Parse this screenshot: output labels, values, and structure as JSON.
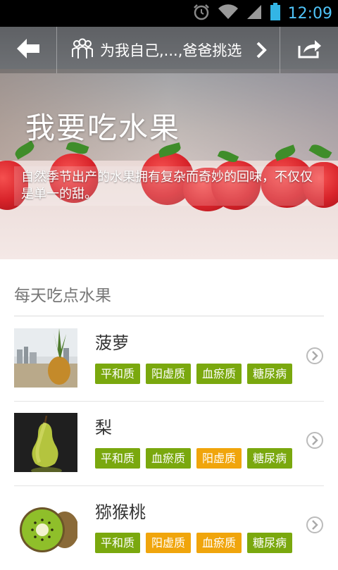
{
  "status_bar": {
    "time": "12:09"
  },
  "header": {
    "selector_label": "为我自己,...,爸爸挑选"
  },
  "hero": {
    "title": "我要吃水果",
    "description": "自然季节出产的水果拥有复杂而奇妙的回味，不仅仅是单一的甜。"
  },
  "section": {
    "title": "每天吃点水果"
  },
  "colors": {
    "tag_green": "#7aa80e",
    "tag_orange": "#f0a50c"
  },
  "fruits": [
    {
      "name": "菠萝",
      "tags": [
        {
          "label": "平和质",
          "color": "green"
        },
        {
          "label": "阳虚质",
          "color": "green"
        },
        {
          "label": "血瘀质",
          "color": "green"
        },
        {
          "label": "糖尿病",
          "color": "green"
        }
      ]
    },
    {
      "name": "梨",
      "tags": [
        {
          "label": "平和质",
          "color": "green"
        },
        {
          "label": "血瘀质",
          "color": "green"
        },
        {
          "label": "阳虚质",
          "color": "orange"
        },
        {
          "label": "糖尿病",
          "color": "green"
        }
      ]
    },
    {
      "name": "猕猴桃",
      "tags": [
        {
          "label": "平和质",
          "color": "green"
        },
        {
          "label": "阳虚质",
          "color": "orange"
        },
        {
          "label": "血瘀质",
          "color": "orange"
        },
        {
          "label": "糖尿病",
          "color": "green"
        }
      ]
    }
  ]
}
